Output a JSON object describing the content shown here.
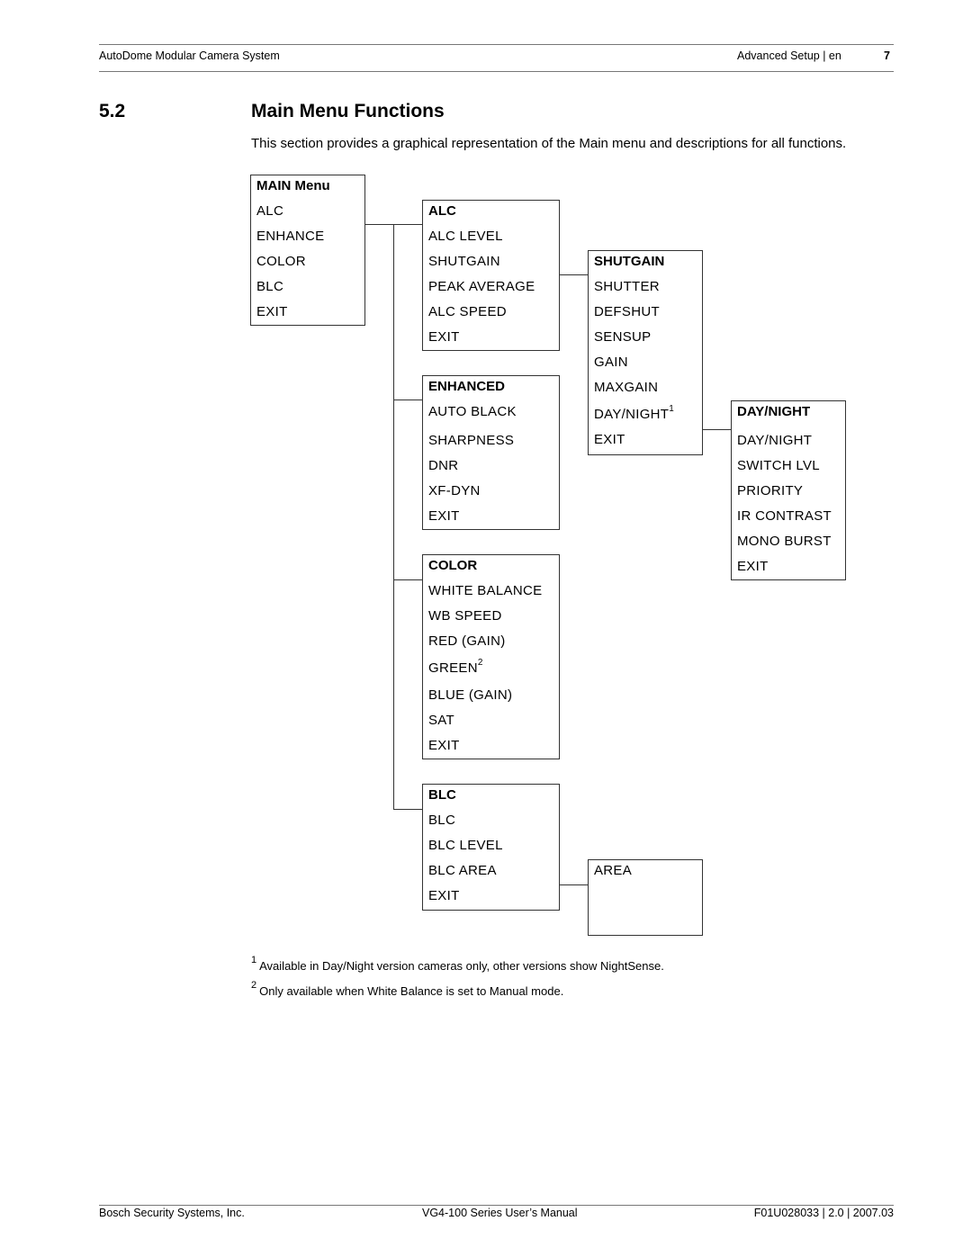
{
  "header": {
    "left": "AutoDome Modular Camera System",
    "right": "Advanced Setup | en",
    "page_number": "7"
  },
  "section": {
    "number": "5.2",
    "title": "Main Menu Functions",
    "intro": "This section provides a graphical representation of the Main menu and descriptions for all functions."
  },
  "menus": {
    "main": {
      "title": "MAIN Menu",
      "items": [
        "ALC",
        "ENHANCE",
        "COLOR",
        "BLC",
        "EXIT"
      ]
    },
    "alc": {
      "title": "ALC",
      "items": [
        "ALC LEVEL",
        "SHUTGAIN",
        "PEAK AVERAGE",
        "ALC SPEED",
        "EXIT"
      ]
    },
    "shutgain": {
      "title": "SHUTGAIN",
      "items": [
        "SHUTTER",
        "DEFSHUT",
        "SENSUP",
        "GAIN",
        "MAXGAIN",
        "DAY/NIGHT",
        "EXIT"
      ],
      "footnote_marker": "1"
    },
    "daynight": {
      "title": "DAY/NIGHT",
      "items": [
        "DAY/NIGHT",
        "SWITCH LVL",
        "PRIORITY",
        "IR CONTRAST",
        "MONO BURST",
        "EXIT"
      ]
    },
    "enhanced": {
      "title": "ENHANCED",
      "items": [
        "AUTO BLACK",
        "SHARPNESS",
        "DNR",
        "XF-DYN",
        "EXIT"
      ]
    },
    "color": {
      "title": "COLOR",
      "items": [
        "WHITE BALANCE",
        "WB SPEED",
        "RED (GAIN)",
        "GREEN",
        "BLUE (GAIN)",
        "SAT",
        "EXIT"
      ],
      "footnote_marker": "2"
    },
    "blc": {
      "title": "BLC",
      "items": [
        "BLC",
        "BLC LEVEL",
        "BLC AREA",
        "EXIT"
      ]
    },
    "area": {
      "items": [
        "AREA"
      ]
    }
  },
  "footnotes": [
    {
      "marker": "1",
      "text": "Available in Day/Night version cameras only, other versions show NightSense."
    },
    {
      "marker": "2",
      "text": "Only available when White Balance is set to Manual mode."
    }
  ],
  "footer": {
    "left": "Bosch Security Systems, Inc.",
    "center": "VG4-100 Series User’s Manual",
    "right": "F01U028033 | 2.0 | 2007.03"
  }
}
